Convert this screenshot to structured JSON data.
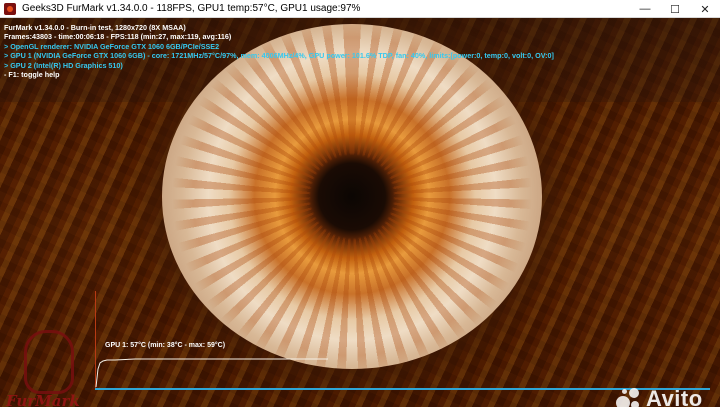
{
  "window": {
    "title": "Geeks3D FurMark v1.34.0.0 - 118FPS, GPU1 temp:57°C, GPU1 usage:97%",
    "minimize_glyph": "—",
    "maximize_glyph": "☐",
    "close_glyph": "✕"
  },
  "overlay": {
    "lines": [
      "FurMark v1.34.0.0 - Burn-in test, 1280x720 (8X MSAA)",
      "Frames:43803 - time:00:06:18 - FPS:118 (min:27, max:119, avg:116)",
      "> OpenGL renderer: NVIDIA GeForce GTX 1060 6GB/PCIe/SSE2",
      "> GPU 1 (NVIDIA GeForce GTX 1060 6GB) - core: 1721MHz/57°C/97%, mem: 4006MHz/4%, GPU power: 101.6% TDP, fan: 40%, limits:[power:0, temp:0, volt:0, OV:0]",
      "> GPU 2 (Intel(R) HD Graphics 510)",
      "- F1: toggle help"
    ]
  },
  "graph": {
    "label": "GPU 1: 57°C (min: 38°C - max: 59°C)",
    "current_temp_c": 57,
    "min_temp_c": 38,
    "max_temp_c": 59
  },
  "logo": {
    "text": "FurMark"
  },
  "watermark": {
    "text": "Avito"
  },
  "colors": {
    "overlay_white": "#ffffff",
    "overlay_cyan": "#35c9f0",
    "graph_baseline": "#2fa6d6",
    "graph_frame": "#b83a14"
  }
}
